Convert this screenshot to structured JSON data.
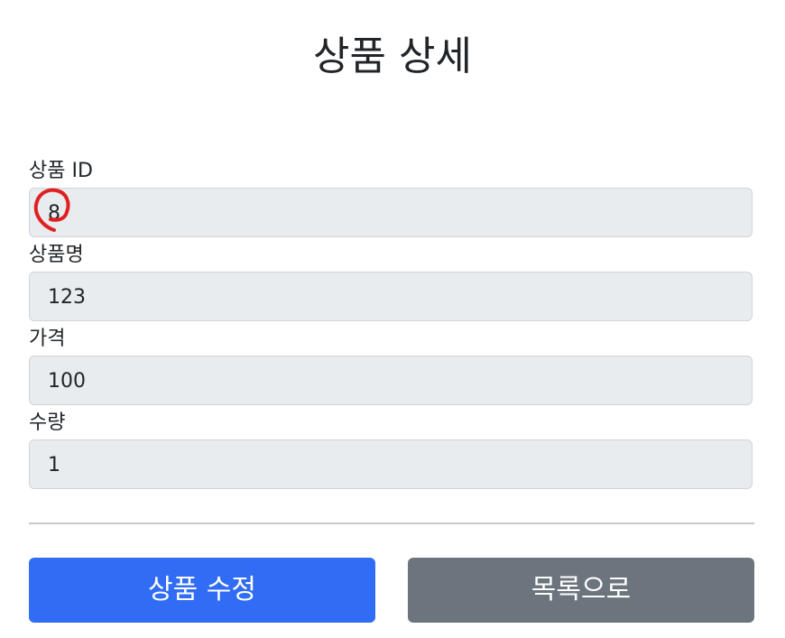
{
  "page": {
    "title": "상품 상세"
  },
  "form": {
    "fields": [
      {
        "label": "상품 ID",
        "value": "8"
      },
      {
        "label": "상품명",
        "value": "123"
      },
      {
        "label": "가격",
        "value": "100"
      },
      {
        "label": "수량",
        "value": "1"
      }
    ]
  },
  "annotation": {
    "color": "#e02020"
  },
  "actions": {
    "edit_label": "상품 수정",
    "list_label": "목록으로",
    "edit_color": "#316cf4",
    "list_color": "#6c757d"
  }
}
